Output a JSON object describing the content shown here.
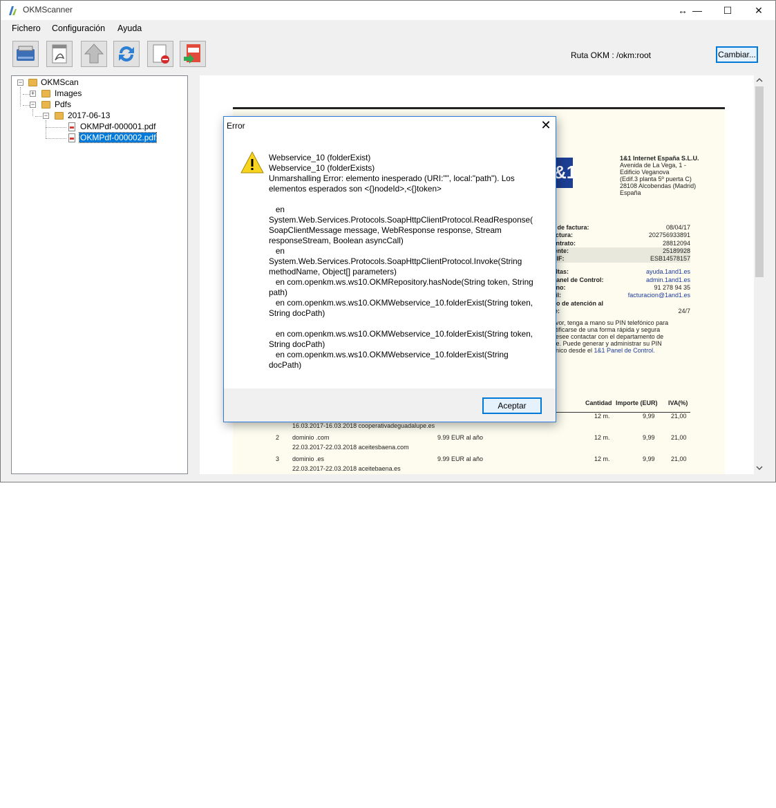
{
  "window": {
    "title": "OKMScanner",
    "resize_glyph": "↔",
    "minimize_glyph": "—",
    "maximize_glyph": "☐",
    "close_glyph": "✕"
  },
  "menu": [
    "Fichero",
    "Configuración",
    "Ayuda"
  ],
  "toolbar": {
    "icons": [
      "scanner-icon",
      "pdf-icon",
      "upload-icon",
      "refresh-icon",
      "delete-document-icon",
      "export-pdf-icon"
    ],
    "ruta_label": "Ruta OKM :",
    "ruta_value": "/okm:root",
    "cambiar_label": "Cambiar..."
  },
  "tree": {
    "root": "OKMScan",
    "images": "Images",
    "pdfs": "Pdfs",
    "date_folder": "2017-06-13",
    "file1": "OKMPdf-000001.pdf",
    "file2": "OKMPdf-000002.pdf",
    "expanded_glyph": "−",
    "collapsed_glyph": "+"
  },
  "preview": {
    "brand": "&1",
    "company": [
      "1&1 Internet España S.L.U.",
      "Avenida de La Vega, 1 -",
      "Edificio Veganova",
      "(Edif.3 planta 5º puerta C)",
      "28108 Alcobendas (Madrid)",
      "España"
    ],
    "fields": [
      {
        "label": "a de factura:",
        "value": "08/04/17"
      },
      {
        "label": "actura:",
        "value": "202756933891"
      },
      {
        "label": "ontrato:",
        "value": "28812094"
      },
      {
        "label": "iente:",
        "value": "25189928"
      },
      {
        "label": "CIF:",
        "value": "ESB14578157"
      },
      {
        "label": "ultas:",
        "value": "ayuda.1and1.es"
      },
      {
        "label": "Panel de Control:",
        "value": "admin.1and1.es"
      },
      {
        "label": "ono:",
        "value": "91 278 94 35"
      },
      {
        "label": "ail:",
        "value": "facturacion@1and1.es"
      },
      {
        "label": "rio de atención al",
        "value": ""
      },
      {
        "label": "te:",
        "value": "24/7"
      }
    ],
    "note": [
      "avor, tenga a mano su PIN telefónico para",
      "ntificarse de una forma rápida y segura",
      "desee contactar con el departamento de",
      "rte. Puede generar y administrar su PIN",
      "ónico desde el "
    ],
    "note_link": "1&1 Panel de Control.",
    "table_headers": [
      "Cantidad",
      "Importe (EUR)",
      "IVA(%)"
    ],
    "rows": [
      {
        "num": "",
        "desc": "",
        "sub": "16.03.2017-16.03.2018 cooperativadeguadalupe.es",
        "price": "",
        "qty": "12 m.",
        "amount": "9,99",
        "iva": "21,00"
      },
      {
        "num": "2",
        "desc": "dominio .com",
        "sub": "22.03.2017-22.03.2018 aceitesbaena.com",
        "price": "9.99 EUR al año",
        "qty": "12 m.",
        "amount": "9,99",
        "iva": "21,00"
      },
      {
        "num": "3",
        "desc": "dominio .es",
        "sub": "22.03.2017-22.03.2018 aceitebaena.es",
        "price": "9.99 EUR al año",
        "qty": "12 m.",
        "amount": "9,99",
        "iva": "21,00"
      }
    ]
  },
  "dialog": {
    "title": "Error",
    "close_glyph": "✕",
    "message": "Webservice_10 (folderExist)\nWebservice_10 (folderExists)\nUnmarshalling Error: elemento inesperado (URI:\"\", local:\"path\"). Los elementos esperados son <{}nodeId>,<{}token>\n\n   en\nSystem.Web.Services.Protocols.SoapHttpClientProtocol.ReadResponse(\nSoapClientMessage message, WebResponse response, Stream responseStream, Boolean asyncCall)\n   en\nSystem.Web.Services.Protocols.SoapHttpClientProtocol.Invoke(String methodName, Object[] parameters)\n   en com.openkm.ws.ws10.OKMRepository.hasNode(String token, String path)\n   en com.openkm.ws.ws10.OKMWebservice_10.folderExist(String token, String docPath)\n\n   en com.openkm.ws.ws10.OKMWebservice_10.folderExist(String token, String docPath)\n   en com.openkm.ws.ws10.OKMWebservice_10.folderExist(String docPath)",
    "ok_label": "Aceptar"
  }
}
